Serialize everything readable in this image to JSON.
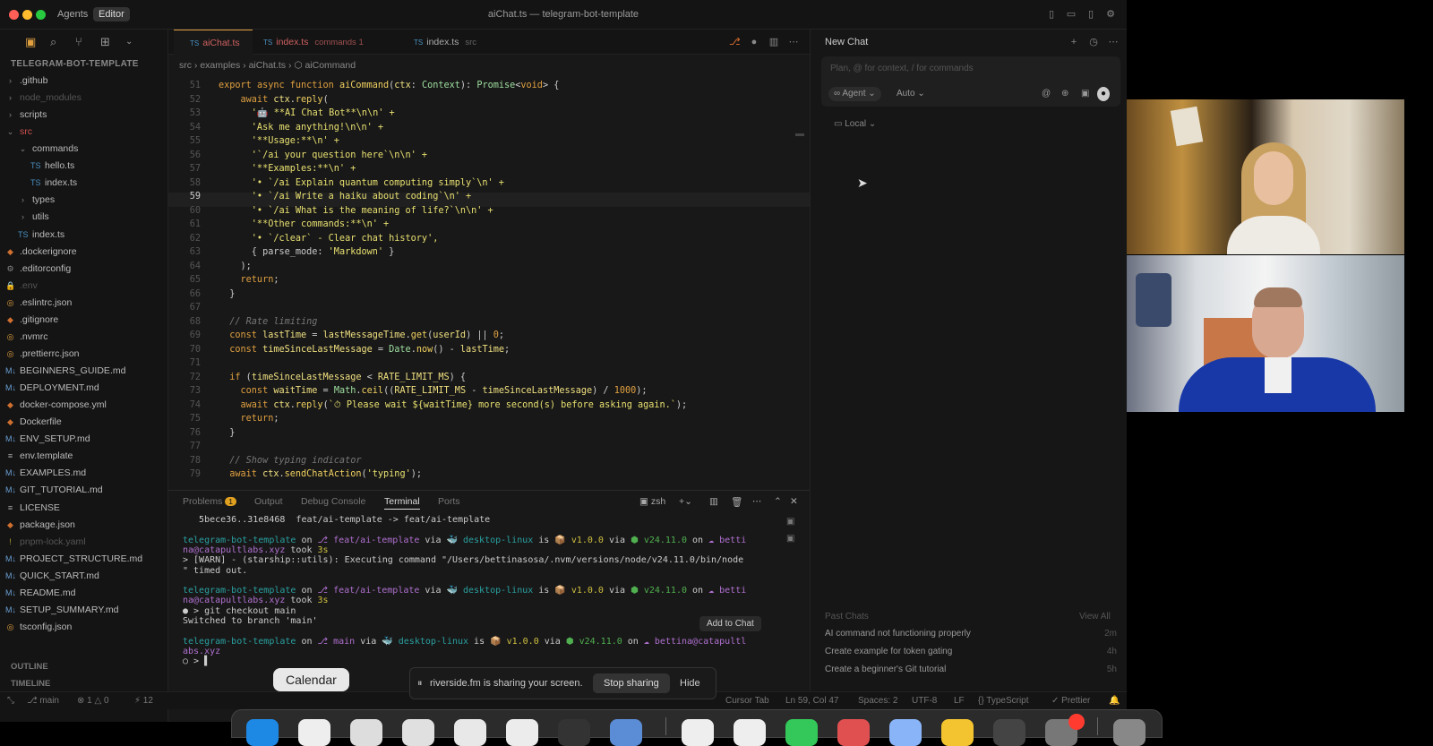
{
  "titlebar": {
    "agents": "Agents",
    "editor": "Editor",
    "title": "aiChat.ts — telegram-bot-template"
  },
  "sidebar": {
    "root": "TELEGRAM-BOT-TEMPLATE",
    "items": [
      {
        "label": ".github",
        "icon": "›",
        "color": "#bbb"
      },
      {
        "label": "node_modules",
        "icon": "›",
        "color": "#555"
      },
      {
        "label": "scripts",
        "icon": "›",
        "color": "#bbb"
      },
      {
        "label": "src",
        "icon": "⌄",
        "color": "#d05050"
      },
      {
        "label": "commands",
        "icon": "⌄",
        "color": "#bbb"
      },
      {
        "label": "hello.ts",
        "icon": "TS",
        "color": "#bbb"
      },
      {
        "label": "index.ts",
        "icon": "TS",
        "color": "#bbb"
      },
      {
        "label": "types",
        "icon": "›",
        "color": "#bbb"
      },
      {
        "label": "utils",
        "icon": "›",
        "color": "#bbb"
      },
      {
        "label": "index.ts",
        "icon": "TS",
        "color": "#bbb"
      },
      {
        "label": ".dockerignore",
        "icon": "◆",
        "color": "#bbb"
      },
      {
        "label": ".editorconfig",
        "icon": "⚙",
        "color": "#bbb"
      },
      {
        "label": ".env",
        "icon": "🔒",
        "color": "#555"
      },
      {
        "label": ".eslintrc.json",
        "icon": "◎",
        "color": "#bbb"
      },
      {
        "label": ".gitignore",
        "icon": "◆",
        "color": "#bbb"
      },
      {
        "label": ".nvmrc",
        "icon": "◎",
        "color": "#bbb"
      },
      {
        "label": ".prettierrc.json",
        "icon": "◎",
        "color": "#bbb"
      },
      {
        "label": "BEGINNERS_GUIDE.md",
        "icon": "M↓",
        "color": "#bbb"
      },
      {
        "label": "DEPLOYMENT.md",
        "icon": "M↓",
        "color": "#bbb"
      },
      {
        "label": "docker-compose.yml",
        "icon": "◆",
        "color": "#bbb"
      },
      {
        "label": "Dockerfile",
        "icon": "◆",
        "color": "#bbb"
      },
      {
        "label": "ENV_SETUP.md",
        "icon": "M↓",
        "color": "#bbb"
      },
      {
        "label": "env.template",
        "icon": "≡",
        "color": "#bbb"
      },
      {
        "label": "EXAMPLES.md",
        "icon": "M↓",
        "color": "#bbb"
      },
      {
        "label": "GIT_TUTORIAL.md",
        "icon": "M↓",
        "color": "#bbb"
      },
      {
        "label": "LICENSE",
        "icon": "≡",
        "color": "#bbb"
      },
      {
        "label": "package.json",
        "icon": "◆",
        "color": "#bbb"
      },
      {
        "label": "pnpm-lock.yaml",
        "icon": "!",
        "color": "#555"
      },
      {
        "label": "PROJECT_STRUCTURE.md",
        "icon": "M↓",
        "color": "#bbb"
      },
      {
        "label": "QUICK_START.md",
        "icon": "M↓",
        "color": "#bbb"
      },
      {
        "label": "README.md",
        "icon": "M↓",
        "color": "#bbb"
      },
      {
        "label": "SETUP_SUMMARY.md",
        "icon": "M↓",
        "color": "#bbb"
      },
      {
        "label": "tsconfig.json",
        "icon": "◎",
        "color": "#bbb"
      }
    ],
    "outline": "OUTLINE",
    "timeline": "TIMELINE"
  },
  "tabs": [
    {
      "label": "aiChat.ts",
      "color": "#d06060"
    },
    {
      "label": "index.ts",
      "sub": "commands 1",
      "color": "#d06060"
    },
    {
      "label": "index.ts",
      "sub": "src",
      "color": "#aaa"
    }
  ],
  "breadcrumb": "src  ›  examples  ›  aiChat.ts  ›  ⬡ aiCommand",
  "code": [
    {
      "n": "51",
      "tokens": [
        [
          "export ",
          "k"
        ],
        [
          "async ",
          "k"
        ],
        [
          "function ",
          "k"
        ],
        [
          "aiCommand",
          "fn"
        ],
        [
          "(",
          "p"
        ],
        [
          "ctx",
          "v"
        ],
        [
          ": ",
          "p"
        ],
        [
          "Context",
          "ty"
        ],
        [
          "): ",
          "p"
        ],
        [
          "Promise",
          "ty"
        ],
        [
          "<",
          "p"
        ],
        [
          "void",
          "k"
        ],
        [
          "> {",
          "p"
        ]
      ]
    },
    {
      "n": "52",
      "tokens": [
        [
          "    await ",
          "k"
        ],
        [
          "ctx",
          "v"
        ],
        [
          ".",
          "p"
        ],
        [
          "reply",
          "fn"
        ],
        [
          "(",
          "p"
        ]
      ]
    },
    {
      "n": "53",
      "tokens": [
        [
          "      '🤖 **AI Chat Bot**\\n\\n' +",
          "s"
        ]
      ]
    },
    {
      "n": "54",
      "tokens": [
        [
          "      'Ask me anything!\\n\\n' +",
          "s"
        ]
      ]
    },
    {
      "n": "55",
      "tokens": [
        [
          "      '**Usage:**\\n' +",
          "s"
        ]
      ]
    },
    {
      "n": "56",
      "tokens": [
        [
          "      '`/ai your question here`\\n\\n' +",
          "s"
        ]
      ]
    },
    {
      "n": "57",
      "tokens": [
        [
          "      '**Examples:**\\n' +",
          "s"
        ]
      ]
    },
    {
      "n": "58",
      "tokens": [
        [
          "      '• `/ai Explain quantum computing simply`\\n' +",
          "s"
        ]
      ]
    },
    {
      "n": "59",
      "tokens": [
        [
          "      '• `/ai Write a haiku about coding`\\n' +",
          "s"
        ]
      ]
    },
    {
      "n": "60",
      "tokens": [
        [
          "      '• `/ai What is the meaning of life?`\\n\\n' +",
          "s"
        ]
      ]
    },
    {
      "n": "61",
      "tokens": [
        [
          "      '**Other commands:**\\n' +",
          "s"
        ]
      ]
    },
    {
      "n": "62",
      "tokens": [
        [
          "      '• `/clear` - Clear chat history',",
          "s"
        ]
      ]
    },
    {
      "n": "63",
      "tokens": [
        [
          "      { parse_mode: ",
          "p"
        ],
        [
          "'Markdown'",
          "s"
        ],
        [
          " }",
          "p"
        ]
      ]
    },
    {
      "n": "64",
      "tokens": [
        [
          "    );",
          "p"
        ]
      ]
    },
    {
      "n": "65",
      "tokens": [
        [
          "    return",
          "k"
        ],
        [
          ";",
          "p"
        ]
      ]
    },
    {
      "n": "66",
      "tokens": [
        [
          "  }",
          "p"
        ]
      ]
    },
    {
      "n": "67",
      "tokens": []
    },
    {
      "n": "68",
      "tokens": [
        [
          "  // Rate limiting",
          "cm"
        ]
      ]
    },
    {
      "n": "69",
      "tokens": [
        [
          "  const ",
          "k"
        ],
        [
          "lastTime",
          "v"
        ],
        [
          " = ",
          "p"
        ],
        [
          "lastMessageTime",
          "v"
        ],
        [
          ".",
          "p"
        ],
        [
          "get",
          "fn"
        ],
        [
          "(",
          "p"
        ],
        [
          "userId",
          "v"
        ],
        [
          ") || ",
          "p"
        ],
        [
          "0",
          "k"
        ],
        [
          ";",
          "p"
        ]
      ]
    },
    {
      "n": "70",
      "tokens": [
        [
          "  const ",
          "k"
        ],
        [
          "timeSinceLastMessage",
          "v"
        ],
        [
          " = ",
          "p"
        ],
        [
          "Date",
          "ty"
        ],
        [
          ".",
          "p"
        ],
        [
          "now",
          "fn"
        ],
        [
          "() - ",
          "p"
        ],
        [
          "lastTime",
          "v"
        ],
        [
          ";",
          "p"
        ]
      ]
    },
    {
      "n": "71",
      "tokens": []
    },
    {
      "n": "72",
      "tokens": [
        [
          "  if ",
          "k"
        ],
        [
          "(",
          "p"
        ],
        [
          "timeSinceLastMessage",
          "v"
        ],
        [
          " < ",
          "p"
        ],
        [
          "RATE_LIMIT_MS",
          "v"
        ],
        [
          ") {",
          "p"
        ]
      ]
    },
    {
      "n": "73",
      "tokens": [
        [
          "    const ",
          "k"
        ],
        [
          "waitTime",
          "v"
        ],
        [
          " = ",
          "p"
        ],
        [
          "Math",
          "ty"
        ],
        [
          ".",
          "p"
        ],
        [
          "ceil",
          "fn"
        ],
        [
          "((",
          "p"
        ],
        [
          "RATE_LIMIT_MS",
          "v"
        ],
        [
          " - ",
          "p"
        ],
        [
          "timeSinceLastMessage",
          "v"
        ],
        [
          ") / ",
          "p"
        ],
        [
          "1000",
          "k"
        ],
        [
          ");",
          "p"
        ]
      ]
    },
    {
      "n": "74",
      "tokens": [
        [
          "    await ",
          "k"
        ],
        [
          "ctx",
          "v"
        ],
        [
          ".",
          "p"
        ],
        [
          "reply",
          "fn"
        ],
        [
          "(",
          "p"
        ],
        [
          "`⏱ Please wait ${waitTime} more second(s) before asking again.`",
          "s"
        ],
        [
          ");",
          "p"
        ]
      ]
    },
    {
      "n": "75",
      "tokens": [
        [
          "    return",
          "k"
        ],
        [
          ";",
          "p"
        ]
      ]
    },
    {
      "n": "76",
      "tokens": [
        [
          "  }",
          "p"
        ]
      ]
    },
    {
      "n": "77",
      "tokens": []
    },
    {
      "n": "78",
      "tokens": [
        [
          "  // Show typing indicator",
          "cm"
        ]
      ]
    },
    {
      "n": "79",
      "tokens": [
        [
          "  await ",
          "k"
        ],
        [
          "ctx",
          "v"
        ],
        [
          ".",
          "p"
        ],
        [
          "sendChatAction",
          "fn"
        ],
        [
          "(",
          "p"
        ],
        [
          "'typing'",
          "s"
        ],
        [
          ");",
          "p"
        ]
      ]
    }
  ],
  "panel": {
    "tabs": [
      "Problems",
      "Output",
      "Debug Console",
      "Terminal",
      "Ports"
    ],
    "problems_count": "1",
    "shell": "zsh",
    "add_to_chat": "Add to Chat"
  },
  "terminal": [
    {
      "segs": [
        [
          "   5bece36..31e8468  feat/ai-template -> feat/ai-template",
          "tw"
        ]
      ]
    },
    {
      "segs": []
    },
    {
      "segs": [
        [
          "telegram-bot-template",
          "tg"
        ],
        [
          " on ",
          "tw"
        ],
        [
          "⎇ feat/ai-template",
          "tp"
        ],
        [
          " via ",
          "tw"
        ],
        [
          "🐳 desktop-linux",
          "tg"
        ],
        [
          " is ",
          "tw"
        ],
        [
          "📦 v1.0.0",
          "ty2"
        ],
        [
          " via ",
          "tw"
        ],
        [
          "⬢ v24.11.0",
          "tgr"
        ],
        [
          " on ",
          "tw"
        ],
        [
          "☁ betti",
          "tp"
        ]
      ]
    },
    {
      "segs": [
        [
          "na@catapultlabs.xyz",
          "tp"
        ],
        [
          " took ",
          "tw"
        ],
        [
          "3s",
          "ty2"
        ]
      ]
    },
    {
      "segs": [
        [
          "> [WARN] - (starship::utils): Executing command \"/Users/bettinasosa/.nvm/versions/node/v24.11.0/bin/node",
          "tw"
        ]
      ]
    },
    {
      "segs": [
        [
          "\" timed out.",
          "tw"
        ]
      ]
    },
    {
      "segs": []
    },
    {
      "segs": [
        [
          "telegram-bot-template",
          "tg"
        ],
        [
          " on ",
          "tw"
        ],
        [
          "⎇ feat/ai-template",
          "tp"
        ],
        [
          " via ",
          "tw"
        ],
        [
          "🐳 desktop-linux",
          "tg"
        ],
        [
          " is ",
          "tw"
        ],
        [
          "📦 v1.0.0",
          "ty2"
        ],
        [
          " via ",
          "tw"
        ],
        [
          "⬢ v24.11.0",
          "tgr"
        ],
        [
          " on ",
          "tw"
        ],
        [
          "☁ betti",
          "tp"
        ]
      ]
    },
    {
      "segs": [
        [
          "na@catapultlabs.xyz",
          "tp"
        ],
        [
          " took ",
          "tw"
        ],
        [
          "3s",
          "ty2"
        ]
      ]
    },
    {
      "segs": [
        [
          "● > git checkout main",
          "tw"
        ]
      ]
    },
    {
      "segs": [
        [
          "Switched to branch 'main'",
          "tw"
        ]
      ]
    },
    {
      "segs": []
    },
    {
      "segs": [
        [
          "telegram-bot-template",
          "tg"
        ],
        [
          " on ",
          "tw"
        ],
        [
          "⎇ main",
          "tp"
        ],
        [
          " via ",
          "tw"
        ],
        [
          "🐳 desktop-linux",
          "tg"
        ],
        [
          " is ",
          "tw"
        ],
        [
          "📦 v1.0.0",
          "ty2"
        ],
        [
          " via ",
          "tw"
        ],
        [
          "⬢ v24.11.0",
          "tgr"
        ],
        [
          " on ",
          "tw"
        ],
        [
          "☁ bettina@catapultl",
          "tp"
        ]
      ]
    },
    {
      "segs": [
        [
          "abs.xyz",
          "tp"
        ]
      ]
    },
    {
      "segs": [
        [
          "○ > ▌",
          "tw"
        ]
      ]
    }
  ],
  "status": {
    "branch": "main",
    "counts": "⊗ 1 △ 0",
    "ports": "⚡ 12",
    "cursor_tab": "Cursor Tab",
    "pos": "Ln 59, Col 47",
    "spaces": "Spaces: 2",
    "enc": "UTF-8",
    "eol": "LF",
    "lang": "{} TypeScript",
    "prettier": "✓ Prettier"
  },
  "chat": {
    "title": "New Chat",
    "placeholder": "Plan, @ for context, / for commands",
    "mode": "∞ Agent",
    "model": "Auto",
    "location": "Local",
    "past_header": "Past Chats",
    "view_all": "View All",
    "past": [
      {
        "title": "AI command not functioning properly",
        "time": "2m"
      },
      {
        "title": "Create example for token gating",
        "time": "4h"
      },
      {
        "title": "Create a beginner's Git tutorial",
        "time": "5h"
      }
    ]
  },
  "overlay": {
    "calendar_tooltip": "Calendar",
    "share_msg": "riverside.fm is sharing your screen.",
    "stop": "Stop sharing",
    "hide": "Hide"
  }
}
